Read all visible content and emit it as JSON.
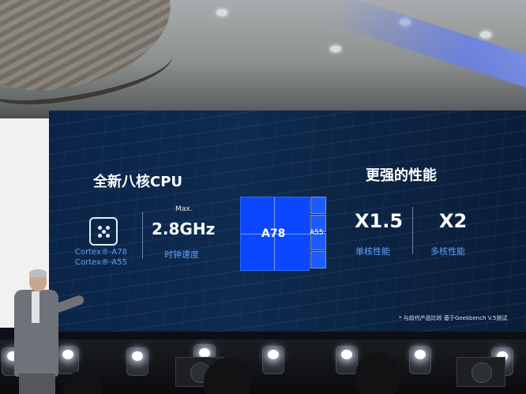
{
  "slide": {
    "left_heading": "全新八核CPU",
    "right_heading": "更强的性能",
    "cortex_a78": "Cortex®-A78",
    "cortex_a55": "Cortex®-A55",
    "max_label": "Max.",
    "clock_value": "2.8GHz",
    "clock_caption": "时钟速度",
    "big_core_label": "A78",
    "little_core_label": "A55",
    "single_core_value": "X1.5",
    "single_core_caption": "单核性能",
    "multi_core_value": "X2",
    "multi_core_caption": "多核性能",
    "footnote": "* 与前代产品比较 基于Geekbench V.5测试"
  },
  "colors": {
    "screen_bg": "#0b2448",
    "accent_blue": "#5fa3ff",
    "core_blue": "#0b47ff"
  },
  "icons": [
    "cpu-chip-icon"
  ]
}
